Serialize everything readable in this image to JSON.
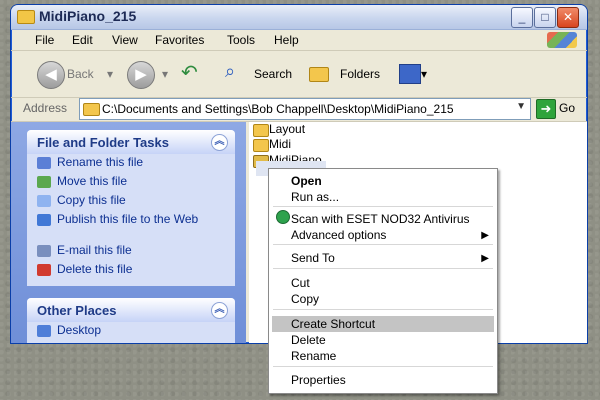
{
  "window": {
    "title": "MidiPiano_215"
  },
  "menu": [
    "File",
    "Edit",
    "View",
    "Favorites",
    "Tools",
    "Help"
  ],
  "toolbar": {
    "back": "Back",
    "search": "Search",
    "folders": "Folders"
  },
  "address": {
    "label": "Address",
    "path": "C:\\Documents and Settings\\Bob Chappell\\Desktop\\MidiPiano_215",
    "go": "Go"
  },
  "tasks": {
    "title": "File and Folder Tasks",
    "items": [
      "Rename this file",
      "Move this file",
      "Copy this file",
      "Publish this file to the Web",
      "E-mail this file",
      "Delete this file"
    ]
  },
  "other_places": {
    "title": "Other Places",
    "items": [
      "Desktop"
    ]
  },
  "files": [
    "Layout",
    "Midi",
    "MidiPiano"
  ],
  "context_menu": [
    "Open",
    "Run as...",
    "Scan with ESET NOD32 Antivirus",
    "Advanced options",
    "Send To",
    "Cut",
    "Copy",
    "Create Shortcut",
    "Delete",
    "Rename",
    "Properties"
  ],
  "colors": {
    "xp_blue": "#0a3ea8",
    "menu_highlight": "#c4c4c4",
    "task_link": "#0c2f91"
  }
}
